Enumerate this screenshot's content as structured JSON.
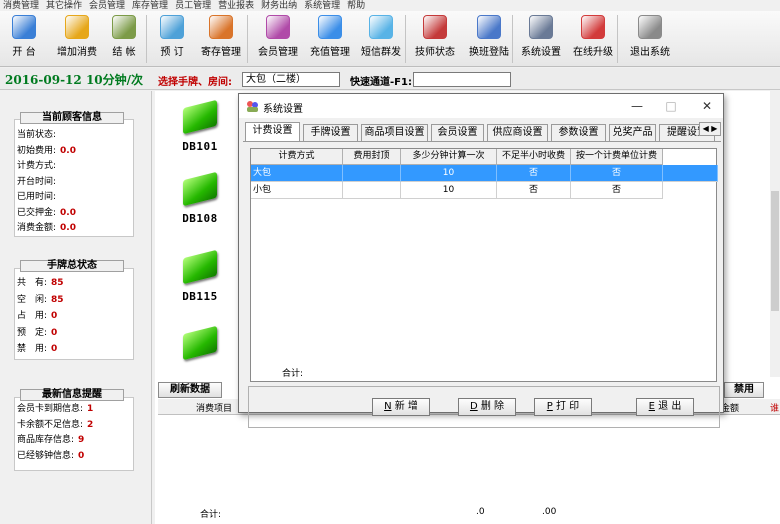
{
  "menu": [
    "消费管理",
    "其它操作",
    "会员管理",
    "库存管理",
    "员工管理",
    "营业报表",
    "财务出纳",
    "系统管理",
    "帮助"
  ],
  "toolbar": [
    {
      "label": "开 台",
      "icon": "people-icon",
      "color": "#3a7fd6"
    },
    {
      "label": "增加消费",
      "icon": "money-icon",
      "color": "#e6a71a"
    },
    {
      "label": "结 帐",
      "icon": "checkout-icon",
      "color": "#7c9b48"
    },
    {
      "label": "预 订",
      "icon": "booking-icon",
      "color": "#4ea1d8"
    },
    {
      "label": "寄存管理",
      "icon": "storage-icon",
      "color": "#d9742a"
    },
    {
      "label": "会员管理",
      "icon": "members-icon",
      "color": "#b04aa8"
    },
    {
      "label": "充值管理",
      "icon": "recharge-icon",
      "color": "#3b8ee8"
    },
    {
      "label": "短信群发",
      "icon": "sms-icon",
      "color": "#58b3e6"
    },
    {
      "label": "技师状态",
      "icon": "technician-icon",
      "color": "#c43a3a"
    },
    {
      "label": "换班登陆",
      "icon": "shift-icon",
      "color": "#4a78c9"
    },
    {
      "label": "系统设置",
      "icon": "settings-icon",
      "color": "#6a7a96"
    },
    {
      "label": "在线升级",
      "icon": "upgrade-icon",
      "color": "#d23b3b"
    },
    {
      "label": "退出系统",
      "icon": "exit-icon",
      "color": "#8a8a8a"
    }
  ],
  "status": {
    "date": "2016-09-12",
    "rate": "10分钟/次",
    "select_label": "选择手牌、房间:",
    "select_value": "大包（二楼）",
    "quick_label": "快速通道-F1:",
    "quick_value": ""
  },
  "customer": {
    "title": "当前顾客信息",
    "rows": [
      {
        "label": "当前状态:",
        "value": ""
      },
      {
        "label": "初始费用:",
        "value": "0.0"
      },
      {
        "label": "计费方式:",
        "value": ""
      },
      {
        "label": "开台时间:",
        "value": ""
      },
      {
        "label": "已用时间:",
        "value": ""
      },
      {
        "label": "已交押金:",
        "value": "0.0"
      },
      {
        "label": "消费金额:",
        "value": "0.0"
      }
    ]
  },
  "handcard": {
    "title": "手牌总状态",
    "rows": [
      {
        "label": "共　有:",
        "value": "85"
      },
      {
        "label": "空　闲:",
        "value": "85"
      },
      {
        "label": "占　用:",
        "value": "0"
      },
      {
        "label": "预　定:",
        "value": "0"
      },
      {
        "label": "禁　用:",
        "value": "0"
      }
    ]
  },
  "alerts": {
    "title": "最新信息提醒",
    "rows": [
      {
        "label": "会员卡到期信息:",
        "value": "1"
      },
      {
        "label": "卡余额不足信息:",
        "value": "2"
      },
      {
        "label": "商品库存信息:",
        "value": "9"
      },
      {
        "label": "已经够钟信息:",
        "value": "0"
      }
    ]
  },
  "rooms": [
    "DB101",
    "DB108",
    "DB115",
    ""
  ],
  "main": {
    "refresh_label": "刷新数据",
    "bottom_hdr_item": "消费项目",
    "bottom_hdr_amount": "金额",
    "bottom_hdr_ban": "禁用",
    "bottom_hdr_red": "谁",
    "footer_total": "合计:",
    "footer_v1": ".0",
    "footer_v2": ".00"
  },
  "dialog": {
    "title": "系统设置",
    "tabs": [
      "计费设置",
      "手牌设置",
      "商品项目设置",
      "会员设置",
      "供应商设置",
      "参数设置",
      "兑奖产品",
      "提醒设置"
    ],
    "columns": [
      "计费方式",
      "费用封顶",
      "多少分钟计算一次",
      "不足半小时收费",
      "按一个计费单位计费"
    ],
    "rows": [
      [
        "大包",
        "",
        "10",
        "否",
        "否"
      ],
      [
        "小包",
        "",
        "10",
        "否",
        "否"
      ]
    ],
    "sum_label": "合计:",
    "buttons": [
      {
        "key": "N",
        "label": "新 增"
      },
      {
        "key": "D",
        "label": "删 除"
      },
      {
        "key": "P",
        "label": "打 印"
      },
      {
        "key": "E",
        "label": "退 出"
      }
    ]
  }
}
